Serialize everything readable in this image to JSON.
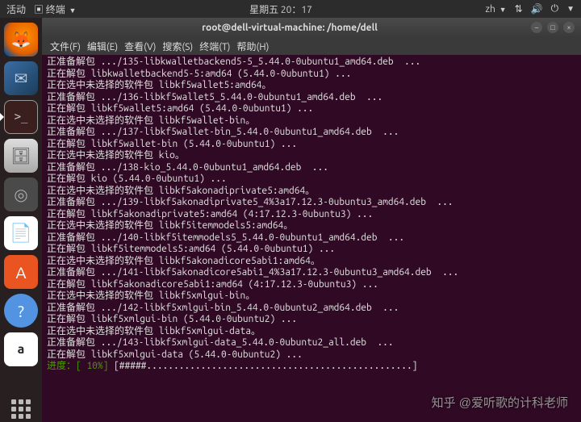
{
  "topbar": {
    "activities": "活动",
    "app_indicator": "终端",
    "clock": "星期五 20：17",
    "lang": "zh"
  },
  "launcher": {
    "firefox": "🦊",
    "thunderbird": "✉",
    "terminal": ">_",
    "files": "🗄",
    "disk": "◎",
    "office": "📄",
    "software": "A",
    "help": "?",
    "amazon": "a"
  },
  "window": {
    "title": "root@dell-virtual-machine: /home/dell",
    "menu": {
      "file": "文件(F)",
      "edit": "编辑(E)",
      "view": "查看(V)",
      "search": "搜索(S)",
      "terminal": "终端(T)",
      "help": "帮助(H)"
    }
  },
  "terminal_lines": [
    "正准备解包 .../135-libkwalletbackend5-5_5.44.0-0ubuntu1_amd64.deb  ...",
    "正在解包 libkwalletbackend5-5:amd64 (5.44.0-0ubuntu1) ...",
    "正在选中未选择的软件包 libkf5wallet5:amd64。",
    "正准备解包 .../136-libkf5wallet5_5.44.0-0ubuntu1_amd64.deb  ...",
    "正在解包 libkf5wallet5:amd64 (5.44.0-0ubuntu1) ...",
    "正在选中未选择的软件包 libkf5wallet-bin。",
    "正准备解包 .../137-libkf5wallet-bin_5.44.0-0ubuntu1_amd64.deb  ...",
    "正在解包 libkf5wallet-bin (5.44.0-0ubuntu1) ...",
    "正在选中未选择的软件包 kio。",
    "正准备解包 .../138-kio_5.44.0-0ubuntu1_amd64.deb  ...",
    "正在解包 kio (5.44.0-0ubuntu1) ...",
    "正在选中未选择的软件包 libkf5akonadiprivate5:amd64。",
    "正准备解包 .../139-libkf5akonadiprivate5_4%3a17.12.3-0ubuntu3_amd64.deb  ...",
    "正在解包 libkf5akonadiprivate5:amd64 (4:17.12.3-0ubuntu3) ...",
    "正在选中未选择的软件包 libkf5itemmodels5:amd64。",
    "正准备解包 .../140-libkf5itemmodels5_5.44.0-0ubuntu1_amd64.deb  ...",
    "正在解包 libkf5itemmodels5:amd64 (5.44.0-0ubuntu1) ...",
    "正在选中未选择的软件包 libkf5akonadicore5abi1:amd64。",
    "正准备解包 .../141-libkf5akonadicore5abi1_4%3a17.12.3-0ubuntu3_amd64.deb  ...",
    "正在解包 libkf5akonadicore5abi1:amd64 (4:17.12.3-0ubuntu3) ...",
    "正在选中未选择的软件包 libkf5xmlgui-bin。",
    "正准备解包 .../142-libkf5xmlgui-bin_5.44.0-0ubuntu2_amd64.deb  ...",
    "正在解包 libkf5xmlgui-bin (5.44.0-0ubuntu2) ...",
    "正在选中未选择的软件包 libkf5xmlgui-data。",
    "正准备解包 .../143-libkf5xmlgui-data_5.44.0-0ubuntu2_all.deb  ...",
    "正在解包 libkf5xmlgui-data (5.44.0-0ubuntu2) ..."
  ],
  "progress": {
    "label": "进度：",
    "percent": "[ 10%]",
    "bar": "[#####.................................................]"
  },
  "watermark": "知乎 @爱听歌的计科老师"
}
